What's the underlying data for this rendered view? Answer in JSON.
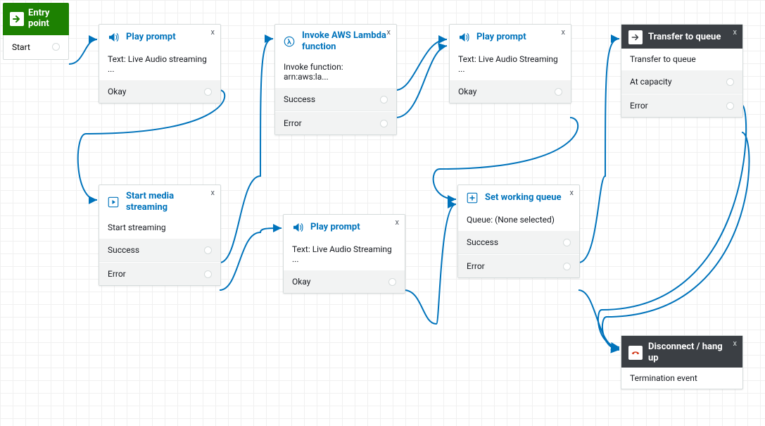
{
  "entry": {
    "title": "Entry point",
    "start": "Start"
  },
  "nodes": {
    "play1": {
      "title": "Play prompt",
      "sub": "Text: Live Audio streaming ...",
      "okay": "Okay"
    },
    "media": {
      "title": "Start media streaming",
      "sub": "Start streaming",
      "success": "Success",
      "error": "Error"
    },
    "lambda": {
      "title": "Invoke AWS Lambda function",
      "sub": "Invoke function: arn:aws:la...",
      "success": "Success",
      "error": "Error"
    },
    "play2": {
      "title": "Play prompt",
      "sub": "Text: Live Audio Streaming ...",
      "okay": "Okay"
    },
    "play3": {
      "title": "Play prompt",
      "sub": "Text: Live Audio Streaming ...",
      "okay": "Okay"
    },
    "setq": {
      "title": "Set working queue",
      "sub": "Queue: (None selected)",
      "success": "Success",
      "error": "Error"
    },
    "transfer": {
      "title": "Transfer to queue",
      "sub": "Transfer to queue",
      "cap": "At capacity",
      "error": "Error"
    },
    "disc": {
      "title": "Disconnect / hang up",
      "sub": "Termination event"
    }
  },
  "close": "x"
}
